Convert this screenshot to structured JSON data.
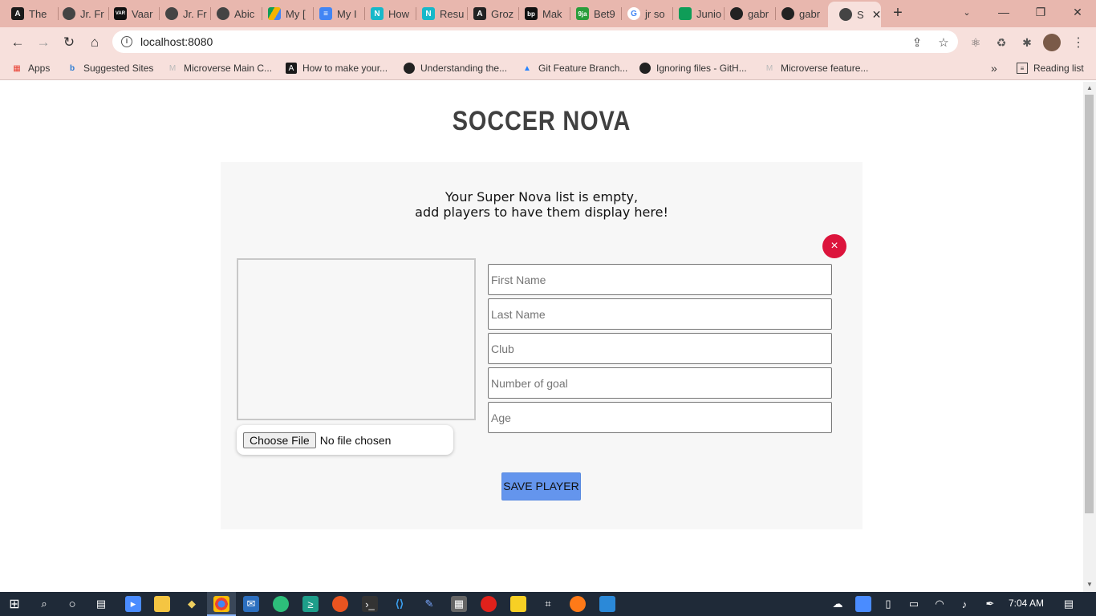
{
  "browser": {
    "tabs": [
      {
        "label": "The",
        "icon": "angular-icon",
        "color": "#1a1a1a"
      },
      {
        "label": "Jr. Fr",
        "icon": "globe-icon",
        "color": "#444"
      },
      {
        "label": "Vaar",
        "icon": "vaar-icon",
        "color": "#111"
      },
      {
        "label": "Jr. Fr",
        "icon": "globe-icon",
        "color": "#444"
      },
      {
        "label": "Abic",
        "icon": "globe-icon",
        "color": "#444"
      },
      {
        "label": "My [",
        "icon": "drive-icon",
        "color": "#f4b400"
      },
      {
        "label": "My I",
        "icon": "docs-icon",
        "color": "#4285f4"
      },
      {
        "label": "How",
        "icon": "n-icon",
        "color": "#17b8c9"
      },
      {
        "label": "Resu",
        "icon": "n-icon",
        "color": "#17b8c9"
      },
      {
        "label": "Groz",
        "icon": "a-icon",
        "color": "#222"
      },
      {
        "label": "Mak",
        "icon": "bp-icon",
        "color": "#111"
      },
      {
        "label": "Bet9",
        "icon": "bet9-icon",
        "color": "#2a9d3b"
      },
      {
        "label": "jr so",
        "icon": "google-icon",
        "color": "#4285f4"
      },
      {
        "label": "Junio",
        "icon": "sheets-icon",
        "color": "#0f9d58"
      },
      {
        "label": "gabr",
        "icon": "github-icon",
        "color": "#222"
      },
      {
        "label": "gabr",
        "icon": "github-icon",
        "color": "#222"
      },
      {
        "label": "S",
        "icon": "globe-icon",
        "color": "#444"
      }
    ],
    "url": "localhost:8080",
    "bookmarks": [
      {
        "label": "Apps",
        "icon": "apps-icon"
      },
      {
        "label": "Suggested Sites",
        "icon": "bing-icon"
      },
      {
        "label": "Microverse Main C...",
        "icon": "microverse-icon"
      },
      {
        "label": "How to make your...",
        "icon": "angular-icon"
      },
      {
        "label": "Understanding the...",
        "icon": "github-icon"
      },
      {
        "label": "Git Feature Branch...",
        "icon": "atlassian-icon"
      },
      {
        "label": "Ignoring files - GitH...",
        "icon": "github-icon"
      },
      {
        "label": "Microverse feature...",
        "icon": "microverse-icon"
      }
    ],
    "reading_list": "Reading list",
    "more_bookmarks": "»"
  },
  "page": {
    "brand": "SOCCER NOVA",
    "empty_line1": "Your Super Nova list is empty,",
    "empty_line2": "add players to have them display here!",
    "close_symbol": "×",
    "file_button": "Choose File",
    "file_status": "No file chosen",
    "fields": {
      "first_name": "First Name",
      "last_name": "Last Name",
      "club": "Club",
      "goals": "Number of goal",
      "age": "Age"
    },
    "save_label": "SAVE PLAYER",
    "accent": "#dc143c",
    "button_color": "#6495ed"
  },
  "taskbar": {
    "clock": "7:04 AM"
  }
}
